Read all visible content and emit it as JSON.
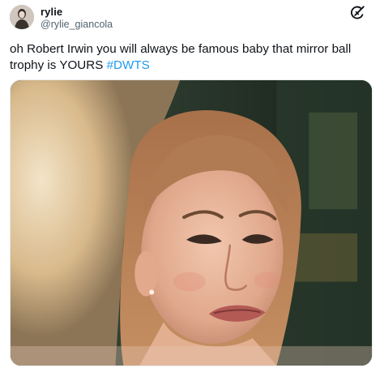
{
  "user": {
    "display_name": "rylie",
    "handle": "@rylie_giancola"
  },
  "header": {
    "logo_icon": "grok-icon"
  },
  "tweet": {
    "text": "oh Robert Irwin you will always be famous baby that mirror ball trophy is YOURS ",
    "hashtag": "#DWTS"
  },
  "media": {
    "kind": "gif-still",
    "subject": "crying-woman-icon"
  },
  "colors": {
    "link": "#1d9bf0",
    "secondary_text": "#536471",
    "primary_text": "#0f1419"
  }
}
